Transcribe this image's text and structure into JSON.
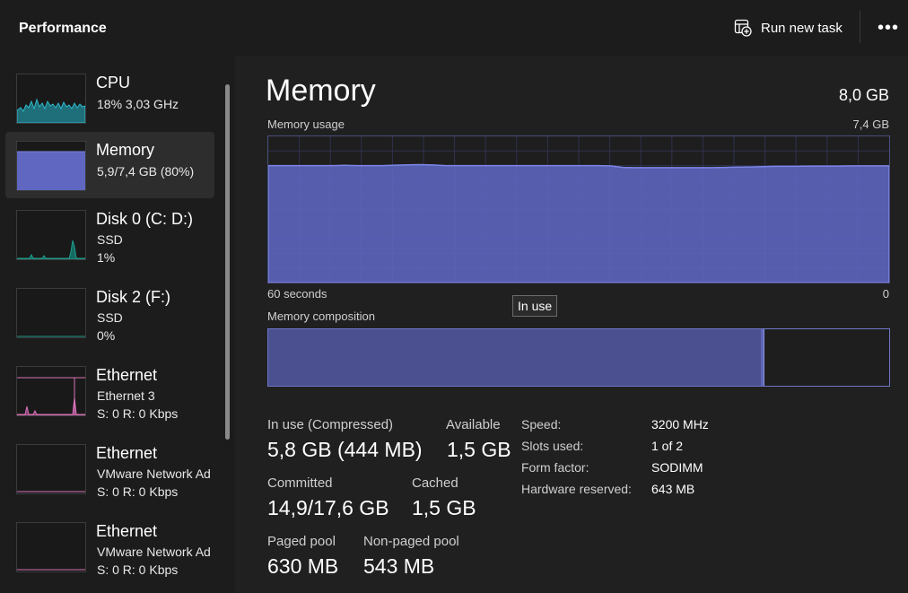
{
  "header": {
    "title": "Performance",
    "run_task_label": "Run new task",
    "run_task_icon": "add-task-icon",
    "more_icon": "more-options-icon",
    "more_glyph": "•••"
  },
  "colors": {
    "memory_fill": "#5f67c1",
    "memory_border": "#6f76c9",
    "cpu": "#2fb7c9",
    "disk": "#1f9c8b",
    "ethernet": "#d773b8"
  },
  "sidebar": {
    "items": [
      {
        "title": "CPU",
        "line1": "18%  3,03 GHz",
        "line2": ""
      },
      {
        "title": "Memory",
        "line1": "5,9/7,4 GB (80%)",
        "line2": "",
        "selected": true
      },
      {
        "title": "Disk 0 (C: D:)",
        "line1": "SSD",
        "line2": "1%"
      },
      {
        "title": "Disk 2 (F:)",
        "line1": "SSD",
        "line2": "0%"
      },
      {
        "title": "Ethernet",
        "line1": "Ethernet 3",
        "line2": "S: 0 R: 0 Kbps"
      },
      {
        "title": "Ethernet",
        "line1": "VMware Network Ad",
        "line2": "S: 0 R: 0 Kbps"
      },
      {
        "title": "Ethernet",
        "line1": "VMware Network Ad",
        "line2": "S: 0 R: 0 Kbps"
      }
    ]
  },
  "main": {
    "title": "Memory",
    "total": "8,0 GB",
    "usage_label": "Memory usage",
    "usage_max": "7,4 GB",
    "time_left": "60 seconds",
    "time_right": "0",
    "tooltip": "In use",
    "composition_label": "Memory composition",
    "composition": {
      "in_use_fraction": 0.793,
      "modified_fraction": 0.005
    },
    "usage_series_percent": [
      80,
      80,
      80,
      80,
      80,
      80,
      80.2,
      80,
      80,
      80,
      80.3,
      80.5,
      80.7,
      80.4,
      80,
      80,
      80,
      80,
      80,
      80,
      80,
      80,
      80,
      80,
      80,
      80,
      80,
      79.8,
      78.8,
      78.6,
      78.6,
      78.6,
      78.6,
      78.6,
      78.6,
      78.6,
      78.8,
      79,
      79.1,
      79.3,
      79.5,
      79.5,
      79.6,
      79.7,
      79.7,
      79.7,
      79.8,
      79.8,
      79.8,
      79.8
    ],
    "stats": {
      "in_use_label": "In use (Compressed)",
      "in_use_value": "5,8 GB (444 MB)",
      "available_label": "Available",
      "available_value": "1,5 GB",
      "committed_label": "Committed",
      "committed_value": "14,9/17,6 GB",
      "cached_label": "Cached",
      "cached_value": "1,5 GB",
      "paged_label": "Paged pool",
      "paged_value": "630 MB",
      "nonpaged_label": "Non-paged pool",
      "nonpaged_value": "543 MB"
    },
    "details": [
      {
        "key": "Speed:",
        "value": "3200 MHz"
      },
      {
        "key": "Slots used:",
        "value": "1 of 2"
      },
      {
        "key": "Form factor:",
        "value": "SODIMM"
      },
      {
        "key": "Hardware reserved:",
        "value": "643 MB"
      }
    ]
  }
}
